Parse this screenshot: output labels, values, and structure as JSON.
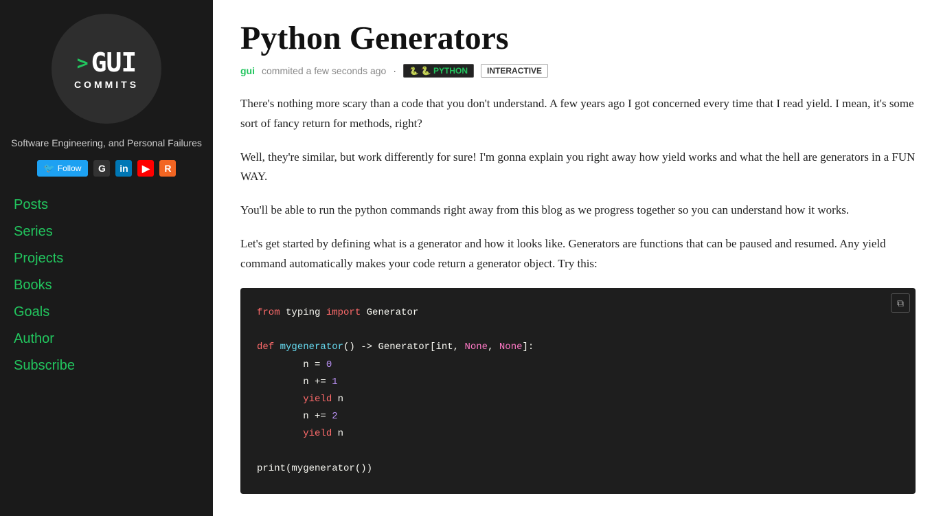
{
  "sidebar": {
    "logo": {
      "arrow": ">",
      "gui": "GUI",
      "commits": "COMMITS"
    },
    "tagline": "Software Engineering, and Personal Failures",
    "social": {
      "follow_label": "Follow",
      "twitter_label": "🐦 Follow",
      "github_label": "G",
      "linkedin_label": "in",
      "youtube_label": "▶",
      "rss_label": "R"
    },
    "nav": [
      {
        "label": "Posts",
        "href": "#posts"
      },
      {
        "label": "Series",
        "href": "#series"
      },
      {
        "label": "Projects",
        "href": "#projects"
      },
      {
        "label": "Books",
        "href": "#books"
      },
      {
        "label": "Goals",
        "href": "#goals"
      },
      {
        "label": "Author",
        "href": "#author"
      },
      {
        "label": "Subscribe",
        "href": "#subscribe"
      }
    ]
  },
  "post": {
    "title": "Python Generators",
    "meta": {
      "author": "gui",
      "action": "commited a few seconds ago",
      "separator": "·"
    },
    "tags": [
      {
        "label": "PYTHON",
        "type": "python"
      },
      {
        "label": "INTERACTIVE",
        "type": "interactive"
      }
    ],
    "paragraphs": [
      "There's nothing more scary than a code that you don't understand. A few years ago I got concerned every time that I read yield. I mean, it's some sort of fancy return for methods, right?",
      "Well, they're similar, but work differently for sure! I'm gonna explain you right away how yield works and what the hell are generators in a FUN WAY.",
      "You'll be able to run the python commands right away from this blog as we progress together so you can understand how it works.",
      "Let's get started by defining what is a generator and how it looks like. Generators are functions that can be paused and resumed. Any yield command automatically makes your code return a generator object. Try this:"
    ],
    "code": {
      "copy_icon": "⧉",
      "lines": [
        {
          "tokens": [
            {
              "t": "from",
              "c": "kw-from"
            },
            {
              "t": " typing ",
              "c": "plain"
            },
            {
              "t": "import",
              "c": "kw-import"
            },
            {
              "t": " Generator",
              "c": "module-name"
            }
          ]
        },
        {
          "tokens": []
        },
        {
          "tokens": [
            {
              "t": "def ",
              "c": "kw-def"
            },
            {
              "t": "mygenerator",
              "c": "fn-name"
            },
            {
              "t": "() -> Generator[int, ",
              "c": "plain"
            },
            {
              "t": "None",
              "c": "none-val"
            },
            {
              "t": ", ",
              "c": "plain"
            },
            {
              "t": "None",
              "c": "none-val"
            },
            {
              "t": "]:",
              "c": "plain"
            }
          ]
        },
        {
          "tokens": [
            {
              "t": "        n = ",
              "c": "plain"
            },
            {
              "t": "0",
              "c": "num-val"
            }
          ]
        },
        {
          "tokens": [
            {
              "t": "        n += ",
              "c": "plain"
            },
            {
              "t": "1",
              "c": "num-val"
            }
          ]
        },
        {
          "tokens": [
            {
              "t": "        ",
              "c": "plain"
            },
            {
              "t": "yield",
              "c": "kw-yield"
            },
            {
              "t": " n",
              "c": "plain"
            }
          ]
        },
        {
          "tokens": [
            {
              "t": "        n += ",
              "c": "plain"
            },
            {
              "t": "2",
              "c": "num-val"
            }
          ]
        },
        {
          "tokens": [
            {
              "t": "        ",
              "c": "plain"
            },
            {
              "t": "yield",
              "c": "kw-yield"
            },
            {
              "t": " n",
              "c": "plain"
            }
          ]
        },
        {
          "tokens": []
        },
        {
          "tokens": [
            {
              "t": "print(mygenerator())",
              "c": "plain"
            }
          ]
        }
      ]
    }
  }
}
